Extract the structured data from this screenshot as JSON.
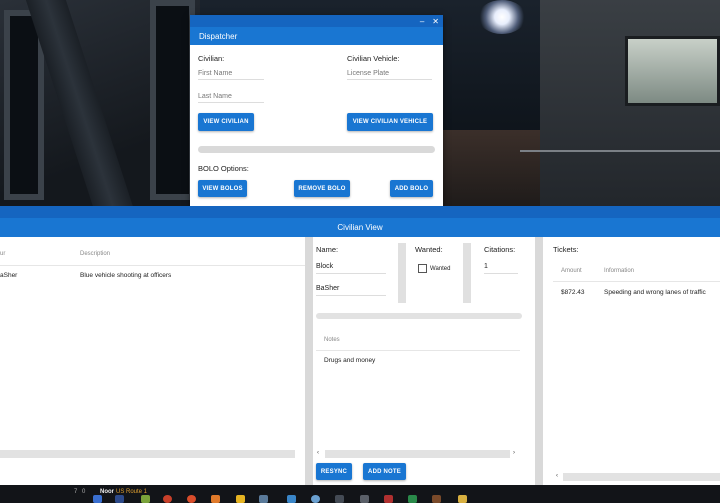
{
  "dispatcher": {
    "title": "Dispatcher",
    "minimize": "–",
    "close": "✕",
    "civilian_label": "Civilian:",
    "first_name_placeholder": "First Name",
    "last_name_placeholder": "Last Name",
    "vehicle_label": "Civilian Vehicle:",
    "plate_placeholder": "License Plate",
    "view_civilian": "VIEW CIVILIAN",
    "view_vehicle": "VIEW CIVILIAN VEHICLE",
    "bolo_label": "BOLO Options:",
    "view_bolos": "VIEW BOLOS",
    "remove_bolo": "REMOVE BOLO",
    "add_bolo": "ADD BOLO"
  },
  "civilian_view": {
    "title": "Civilian View",
    "bolo_table": {
      "headers": [
        "ur",
        "Description"
      ],
      "rows": [
        {
          "owner": "aSher",
          "description": "Blue vehicle shooting at officers"
        }
      ]
    },
    "name_label": "Name:",
    "first_name": "Block",
    "last_name": "BaSher",
    "wanted_label": "Wanted:",
    "wanted_checkbox_label": "Wanted",
    "citations_label": "Citations:",
    "citations_value": "1",
    "notes_header": "Notes",
    "notes_text": "Drugs and money",
    "resync": "RESYNC",
    "add_note": "ADD NOTE",
    "tickets_label": "Tickets:",
    "tickets_table": {
      "headers": [
        "Amount",
        "Information"
      ],
      "rows": [
        {
          "amount": "$872.43",
          "information": "Speeding and wrong lanes of traffic"
        }
      ]
    }
  },
  "taskbar": {
    "num": "7",
    "speed": "0",
    "direction": "Noor",
    "road": "US Route 1"
  },
  "colors": {
    "primary": "#1976d2",
    "primary_dark": "#1565c0"
  }
}
